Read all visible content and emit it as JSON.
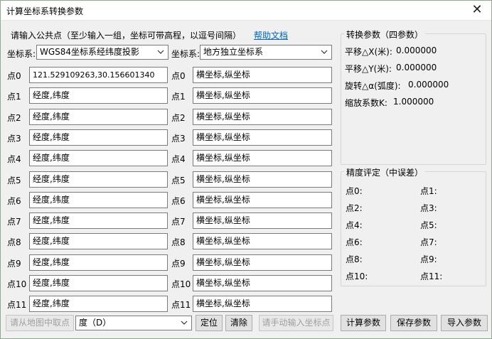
{
  "window": {
    "title": "计算坐标系转换参数",
    "close_glyph": "✕"
  },
  "left": {
    "instruction": "请输入公共点（至少输入一组，坐标可带高程，以逗号间隔）",
    "help_link": "帮助文档",
    "src_label": "坐标系:",
    "src_value": "WGS84坐标系经纬度投影",
    "dst_label": "坐标系:",
    "dst_value": "地方独立坐标系",
    "points_src": [
      {
        "label": "点0",
        "value": "121.529109263,30.156601340"
      },
      {
        "label": "点1",
        "value": "经度,纬度"
      },
      {
        "label": "点2",
        "value": "经度,纬度"
      },
      {
        "label": "点3",
        "value": "经度,纬度"
      },
      {
        "label": "点4",
        "value": "经度,纬度"
      },
      {
        "label": "点5",
        "value": "经度,纬度"
      },
      {
        "label": "点6",
        "value": "经度,纬度"
      },
      {
        "label": "点7",
        "value": "经度,纬度"
      },
      {
        "label": "点8",
        "value": "经度,纬度"
      },
      {
        "label": "点9",
        "value": "经度,纬度"
      },
      {
        "label": "点10",
        "value": "经度,纬度"
      },
      {
        "label": "点11",
        "value": "经度,纬度"
      }
    ],
    "points_dst": [
      {
        "label": "点0",
        "value": "横坐标,纵坐标"
      },
      {
        "label": "点1",
        "value": "横坐标,纵坐标"
      },
      {
        "label": "点2",
        "value": "横坐标,纵坐标"
      },
      {
        "label": "点3",
        "value": "横坐标,纵坐标"
      },
      {
        "label": "点4",
        "value": "横坐标,纵坐标"
      },
      {
        "label": "点5",
        "value": "横坐标,纵坐标"
      },
      {
        "label": "点6",
        "value": "横坐标,纵坐标"
      },
      {
        "label": "点7",
        "value": "横坐标,纵坐标"
      },
      {
        "label": "点8",
        "value": "横坐标,纵坐标"
      },
      {
        "label": "点9",
        "value": "横坐标,纵坐标"
      },
      {
        "label": "点10",
        "value": "横坐标,纵坐标"
      },
      {
        "label": "点11",
        "value": "横坐标,纵坐标"
      }
    ],
    "map_pick_button": "请从地图中取点",
    "unit_value": "度（D）",
    "locate_button": "定位",
    "clear_button": "清除",
    "manual_input_button": "请手动输入坐标点"
  },
  "params": {
    "title": "转换参数（四参数）",
    "shift_x_label": "平移△X(米):",
    "shift_x_value": "0.000000",
    "shift_y_label": "平移△Y(米):",
    "shift_y_value": "0.000000",
    "rotation_label": "旋转△α(弧度):",
    "rotation_value": "0.000000",
    "scale_label": "缩放系数K:",
    "scale_value": "1.000000"
  },
  "accuracy": {
    "title": "精度评定（中误差）",
    "items_left": [
      "点0:",
      "点2:",
      "点4:",
      "点6:",
      "点8:",
      "点10:"
    ],
    "items_right": [
      "点1:",
      "点3:",
      "点5:",
      "点7:",
      "点9:",
      "点11:"
    ]
  },
  "actions": {
    "compute_button": "计算参数",
    "save_button": "保存参数",
    "import_button": "导入参数"
  }
}
